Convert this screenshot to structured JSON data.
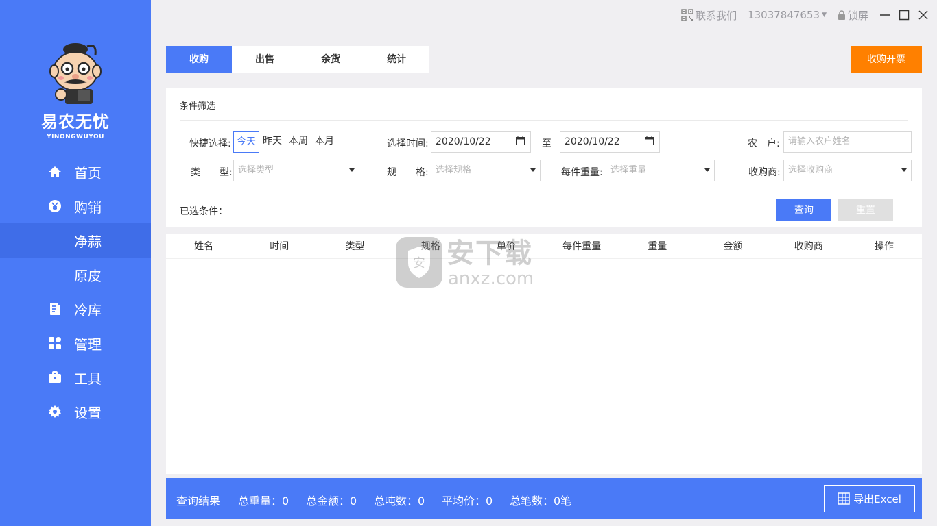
{
  "brand": {
    "name": "易农无忧",
    "sub": "YINONGWUYOU"
  },
  "nav": [
    {
      "label": "首页",
      "icon": "home-icon"
    },
    {
      "label": "购销",
      "icon": "yen-icon"
    },
    {
      "label": "净蒜",
      "icon": ""
    },
    {
      "label": "原皮",
      "icon": ""
    },
    {
      "label": "冷库",
      "icon": "document-icon"
    },
    {
      "label": "管理",
      "icon": "grid-icon"
    },
    {
      "label": "工具",
      "icon": "toolbox-icon"
    },
    {
      "label": "设置",
      "icon": "gear-icon"
    }
  ],
  "titlebar": {
    "contact": "联系我们",
    "phone": "13037847653",
    "lock": "锁屏"
  },
  "tabs": [
    "收购",
    "出售",
    "余货",
    "统计"
  ],
  "invoice_button": "收购开票",
  "filter": {
    "title": "条件筛选",
    "quick_label": "快捷选择:",
    "quick_options": [
      "今天",
      "昨天",
      "本周",
      "本月"
    ],
    "time_label": "选择时间:",
    "date_from": "2020/10/22",
    "to_label": "至",
    "date_to": "2020/10/22",
    "farmer_label": "农　户:",
    "farmer_placeholder": "请输入农户姓名",
    "type_label": "类　　型:",
    "type_placeholder": "选择类型",
    "spec_label": "规　　格:",
    "spec_placeholder": "选择规格",
    "weight_label": "每件重量:",
    "weight_placeholder": "选择重量",
    "buyer_label": "收购商:",
    "buyer_placeholder": "选择收购商",
    "selected_label": "已选条件：",
    "query_button": "查询",
    "reset_button": "重置"
  },
  "table": {
    "headers": [
      "姓名",
      "时间",
      "类型",
      "规格",
      "单价",
      "每件重量",
      "重量",
      "金额",
      "收购商",
      "操作"
    ]
  },
  "watermark": {
    "text_cn": "安下载",
    "text_en": "anxz.com"
  },
  "footer": {
    "result_label": "查询结果",
    "total_weight": "总重量：0",
    "total_amount": "总金额：0",
    "total_tons": "总吨数：0",
    "avg_price": "平均价：0",
    "total_count": "总笔数：0笔",
    "export_button": "导出Excel"
  }
}
